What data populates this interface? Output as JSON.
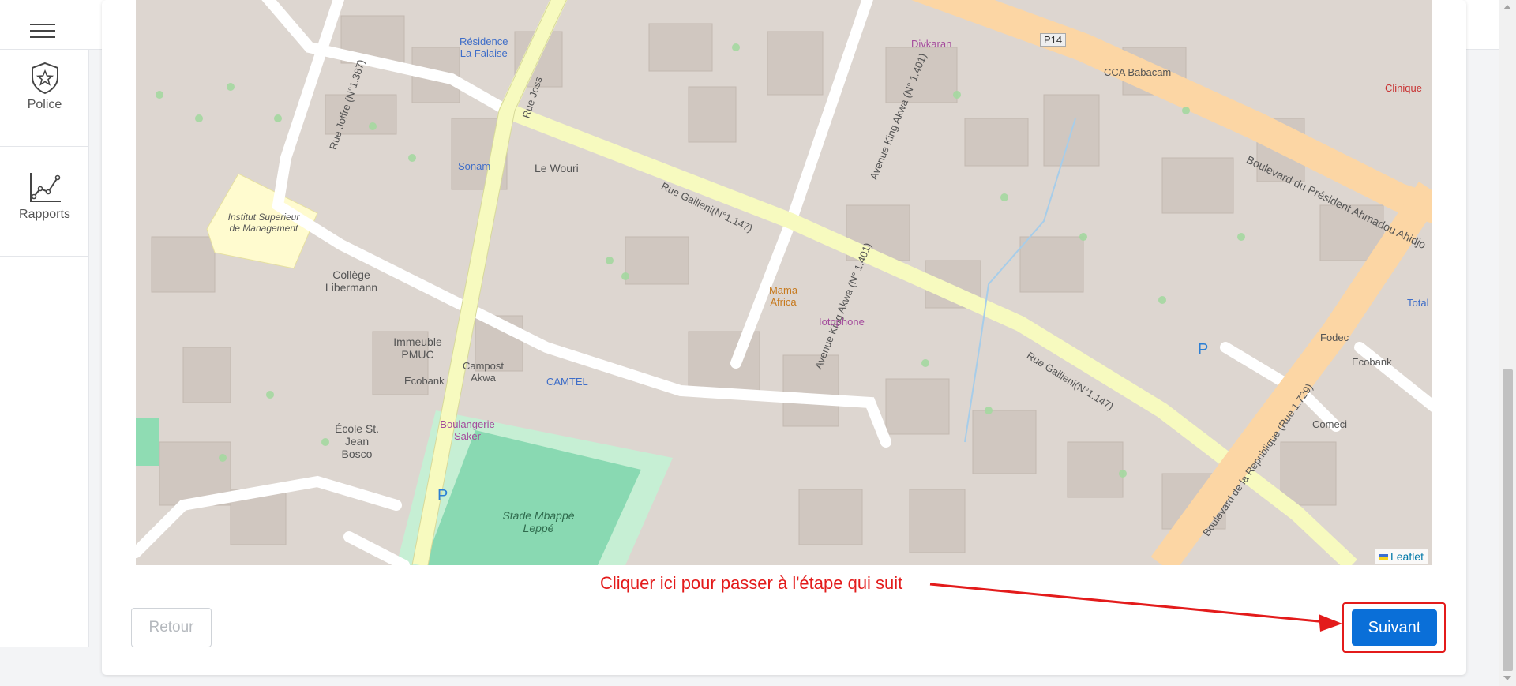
{
  "header": {
    "menu_icon": "hamburger-icon"
  },
  "sidebar": {
    "items": [
      {
        "label": "Police",
        "icon": "police-badge-icon"
      },
      {
        "label": "Rapports",
        "icon": "line-chart-icon"
      }
    ]
  },
  "map": {
    "attribution": "Leaflet",
    "labels": {
      "residence": "Résidence\nLa Falaise",
      "divkaran": "Divkaran",
      "p14": "P14",
      "cca": "CCA Babacam",
      "clinique": "Clinique",
      "rue_joffre": "Rue Joffre (N°1.387)",
      "rue_joss": "Rue Joss",
      "sonam": "Sonam",
      "le_wouri": "Le Wouri",
      "rue_gallieni_1": "Rue Gallieni(N°1.147)",
      "rue_gallieni_2": "Rue Gallieni(N°1.147)",
      "avenue_king_1": "Avenue King Akwa (N° 1.401)",
      "avenue_king_2": "Avenue King Akwa (N° 1.401)",
      "boulevard_president": "Boulevard du Président Ahmadou Ahidjo",
      "institut": "Institut Superieur de Management",
      "college": "Collège Libermann",
      "mama_africa": "Mama Africa",
      "iotophone": "Iotophone",
      "immeuble": "Immeuble PMUC",
      "ecobank_1": "Ecobank",
      "campost": "Campost Akwa",
      "camtel": "CAMTEL",
      "ecole": "École St. Jean Bosco",
      "boulangerie": "Boulangerie Saker",
      "stade": "Stade Mbappé Leppé",
      "fodec": "Fodec",
      "ecobank_2": "Ecobank",
      "comeci": "Comeci",
      "total": "Total",
      "boulevard_republique": "Boulevard de la République (Rue 1.729)",
      "parking": "P"
    }
  },
  "actions": {
    "retour_label": "Retour",
    "suivant_label": "Suivant"
  },
  "annotation": {
    "text": "Cliquer ici pour passer à l'étape qui suit"
  }
}
